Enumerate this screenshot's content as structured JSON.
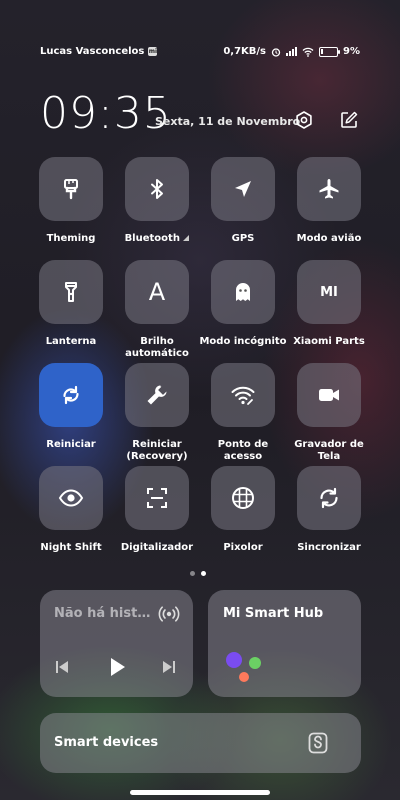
{
  "status_bar": {
    "user_name": "Lucas Vasconcelos",
    "user_badge": "mi",
    "speed": "0,7KB/s",
    "battery": "9%",
    "battery_level": 0.09
  },
  "header": {
    "time": "09:35",
    "date": "Sexta, 11 de Novembro",
    "settings_icon": "gear-icon",
    "edit_icon": "edit-icon"
  },
  "tiles": [
    {
      "label": "Theming",
      "icon": "brush-icon",
      "active": false
    },
    {
      "label": "Bluetooth",
      "icon": "bluetooth-icon",
      "active": false
    },
    {
      "label": "GPS",
      "icon": "location-arrow-icon",
      "active": false
    },
    {
      "label": "Modo avião",
      "icon": "airplane-icon",
      "active": false
    },
    {
      "label": "Lanterna",
      "icon": "flashlight-icon",
      "active": false
    },
    {
      "label": "Brilho automático",
      "icon": "auto-brightness-icon",
      "glyph": "A",
      "active": false
    },
    {
      "label": "Modo incógnito",
      "icon": "ghost-icon",
      "active": false
    },
    {
      "label": "Xiaomi Parts",
      "icon": "mi-logo-icon",
      "glyph": "MI",
      "active": false
    },
    {
      "label": "Reiniciar",
      "icon": "restart-icon",
      "active": true
    },
    {
      "label": "Reiniciar (Recovery)",
      "icon": "wrench-icon",
      "active": false
    },
    {
      "label": "Ponto de acesso",
      "icon": "hotspot-icon",
      "active": false
    },
    {
      "label": "Gravador de Tela",
      "icon": "video-camera-icon",
      "active": false
    },
    {
      "label": "Night Shift",
      "icon": "eye-icon",
      "active": false
    },
    {
      "label": "Digitalizador",
      "icon": "scan-icon",
      "active": false
    },
    {
      "label": "Pixolor",
      "icon": "grid-circle-icon",
      "active": false
    },
    {
      "label": "Sincronizar",
      "icon": "sync-icon",
      "active": false
    }
  ],
  "media": {
    "title": "Não há histórico",
    "cast_icon": "cast-icon",
    "prev_icon": "previous-icon",
    "play_icon": "play-icon",
    "next_icon": "next-icon"
  },
  "smart_hub": {
    "title": "Mi Smart Hub",
    "logo_icon": "smart-hub-dots-icon"
  },
  "smart_devices": {
    "title": "Smart devices",
    "icon": "smart-devices-icon"
  },
  "colors": {
    "active_tile": "#2f63c9",
    "tile": "#77757f"
  }
}
